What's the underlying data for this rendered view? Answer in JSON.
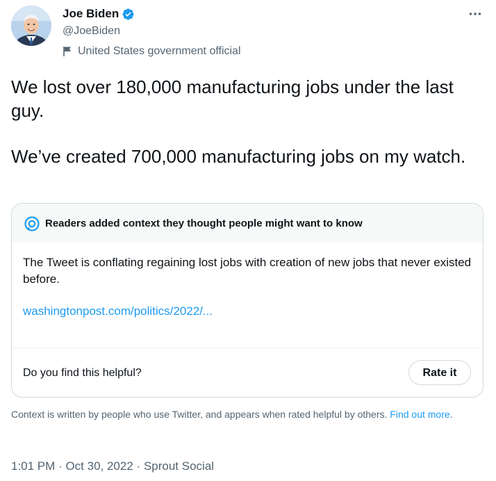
{
  "author": {
    "name": "Joe Biden",
    "handle": "@JoeBiden",
    "affiliation": "United States government official",
    "avatar_icon": "avatar-photo",
    "verified_icon": "verified-badge-icon",
    "affiliation_icon": "flag-icon"
  },
  "menu": {
    "more_icon": "more-options-icon"
  },
  "tweet": {
    "paragraphs": [
      "We lost over 180,000 manufacturing jobs under the last guy.",
      "We’ve created 700,000 manufacturing jobs on my watch."
    ]
  },
  "context": {
    "title": "Readers added context they thought people might want to know",
    "body": "The Tweet is conflating regaining lost jobs with creation of new jobs that never existed before.",
    "link": "washingtonpost.com/politics/2022/...",
    "helpful_question": "Do you find this helpful?",
    "rate_label": "Rate it",
    "note": "Context is written by people who use Twitter, and appears when rated helpful by others.",
    "find_out_more": "Find out more",
    "note_end": "."
  },
  "meta": {
    "time": "1:01 PM",
    "separator": "·",
    "date": "Oct 30, 2022",
    "source": "Sprout Social"
  },
  "colors": {
    "accent": "#1d9bf0",
    "muted": "#536471",
    "text": "#0f1419",
    "border": "#cfd9de"
  }
}
